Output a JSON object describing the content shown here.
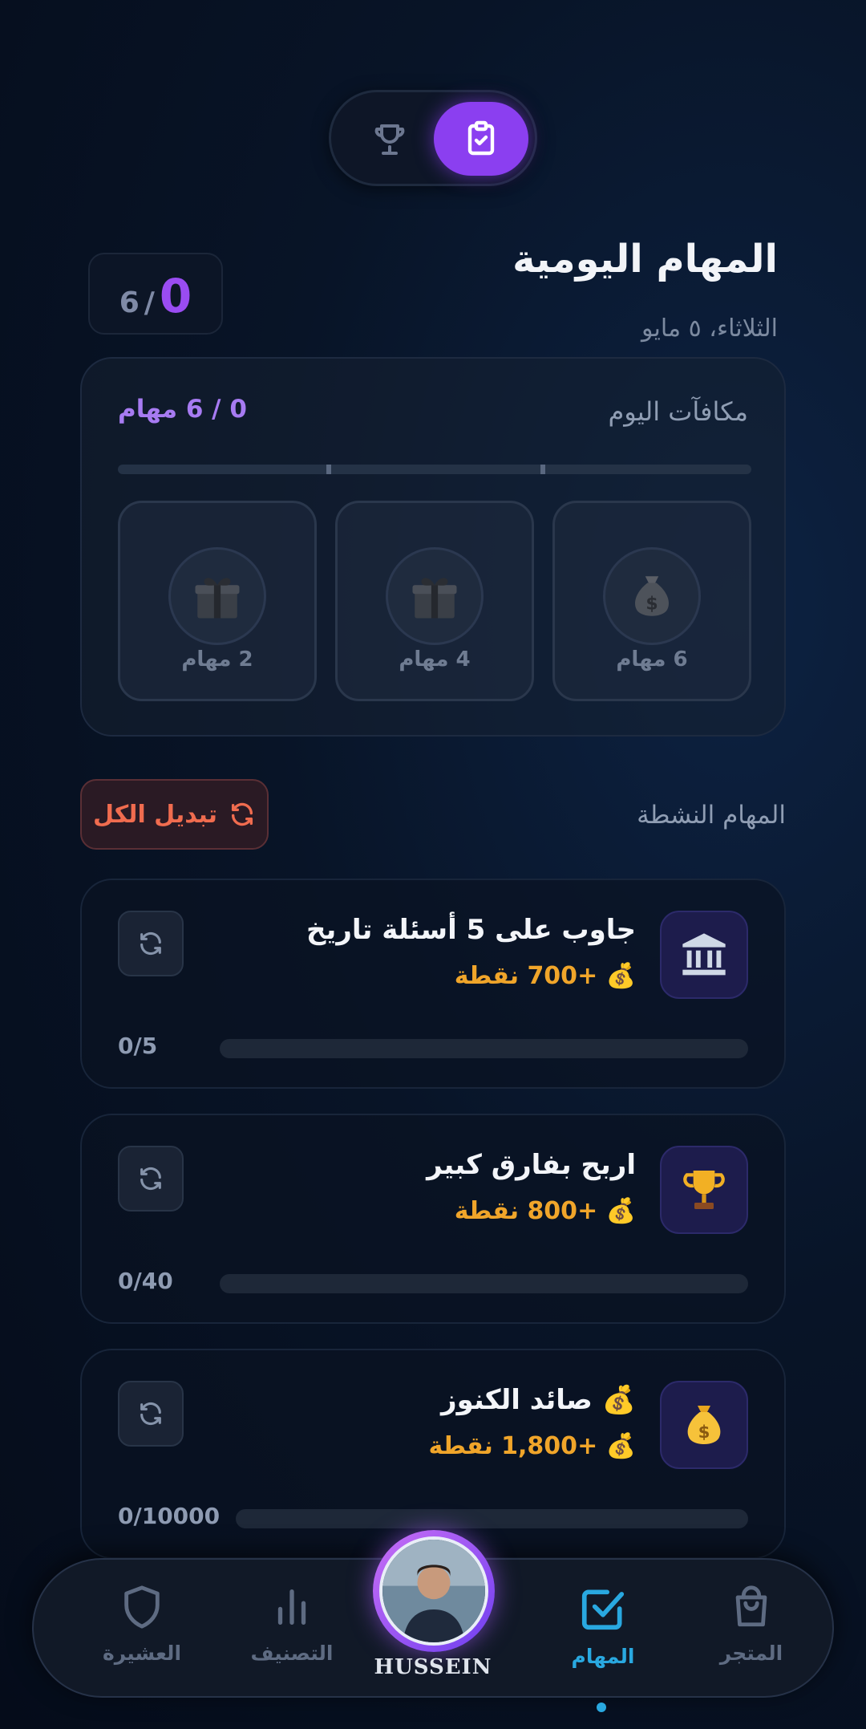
{
  "toggle": {
    "trophy_icon": "trophy-icon",
    "tasks_icon": "clipboard-check-icon",
    "active": "tasks"
  },
  "header": {
    "title": "المهام اليومية",
    "date": "الثلاثاء، ٥ مايو"
  },
  "score": {
    "current": "0",
    "separator": "/",
    "total": "6"
  },
  "rewards": {
    "title": "مكافآت اليوم",
    "count_label": "0 / 6 مهام",
    "progress": 0,
    "tiles": [
      {
        "label": "2 مهام",
        "icon": "gift-icon"
      },
      {
        "label": "4 مهام",
        "icon": "gift-icon"
      },
      {
        "label": "6 مهام",
        "icon": "money-bag-icon"
      }
    ]
  },
  "active": {
    "title": "المهام النشطة",
    "swap_all": "تبديل الكل"
  },
  "tasks": [
    {
      "name": "جاوب على 5 أسئلة تاريخ",
      "reward": "💰 +700 نقطة",
      "progress": "0/5",
      "icon": "bank-icon"
    },
    {
      "name": "اربح بفارق كبير",
      "reward": "💰 +800 نقطة",
      "progress": "0/40",
      "icon": "trophy-icon"
    },
    {
      "name": "💰 صائد الكنوز",
      "reward": "💰 +1,800 نقطة",
      "progress": "0/10000",
      "icon": "money-bag-icon"
    }
  ],
  "nav": {
    "clan": "العشيرة",
    "ranking": "التصنيف",
    "profile_name": "HUSSEIN",
    "tasks": "المهام",
    "store": "المتجر",
    "active": "tasks"
  },
  "colors": {
    "accent": "#8b3ff0",
    "active_nav": "#29a8e0",
    "reward": "#f0a52a",
    "swap": "#f06c4f"
  }
}
